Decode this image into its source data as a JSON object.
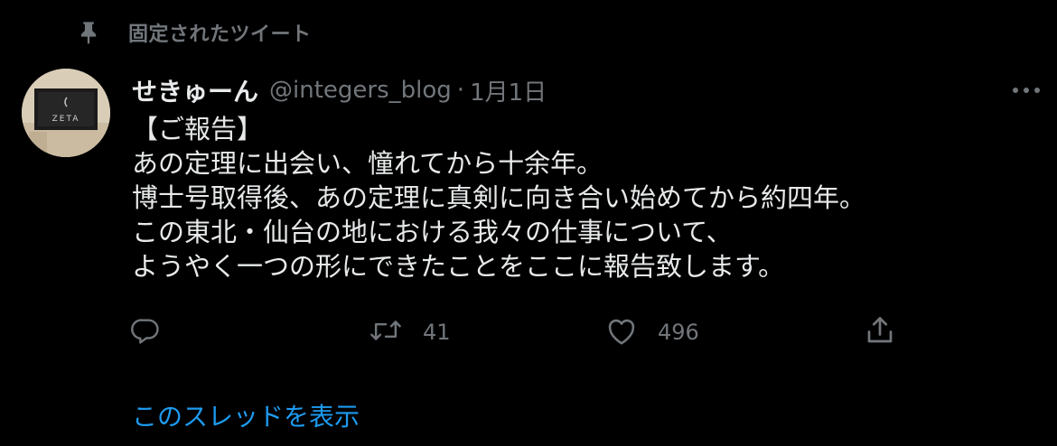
{
  "pinned": {
    "label": "固定されたツイート",
    "icon": "pin-icon"
  },
  "author": {
    "display_name": "せきゅーん",
    "handle": "@integers_blog",
    "separator": "·",
    "date": "1月1日",
    "avatar_text": "ZETA"
  },
  "tweet": {
    "lines": [
      "【ご報告】",
      "あの定理に出会い、憧れてから十余年。",
      "博士号取得後、あの定理に真剣に向き合い始めてから約四年。",
      "この東北・仙台の地における我々の仕事について、",
      "ようやく一つの形にできたことをここに報告致します。"
    ]
  },
  "actions": {
    "reply": {
      "icon": "reply-icon",
      "count": ""
    },
    "retweet": {
      "icon": "retweet-icon",
      "count": "41"
    },
    "like": {
      "icon": "heart-icon",
      "count": "496"
    },
    "share": {
      "icon": "share-icon"
    }
  },
  "more": {
    "icon": "more-icon"
  },
  "thread_link": {
    "label": "このスレッドを表示"
  },
  "colors": {
    "background": "#000000",
    "text_primary": "#e7e9ea",
    "text_secondary": "#71767b",
    "link": "#1d9bf0"
  }
}
